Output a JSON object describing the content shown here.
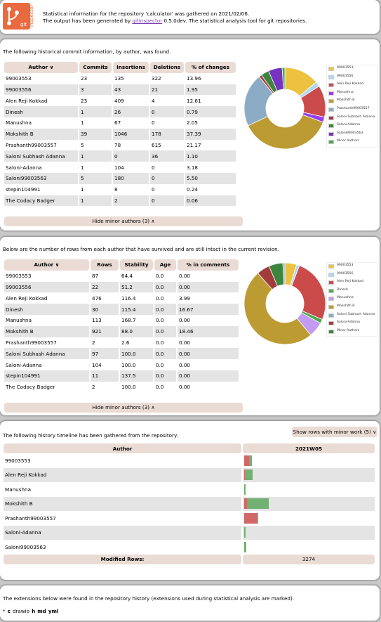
{
  "header": {
    "logo_text": "git",
    "logo_side_text": "inspector",
    "line1": "Statistical information for the repository 'calculator' was gathered on 2021/02/06.",
    "line2_prefix": "The output has been generated by ",
    "line2_link": "gitinspector",
    "line2_suffix": " 0.5.0dev. The statistical analysis tool for git repositories."
  },
  "colors": {
    "pie": [
      "#edc240",
      "#afd8f8",
      "#cb4b4b",
      "#4da74d",
      "#9440ed",
      "#bd9b33",
      "#8cacc6",
      "#a23c3c",
      "#3d853d",
      "#7633bd",
      "#4da74d",
      "#cba63a"
    ]
  },
  "commits": {
    "intro": "The following historical commit information, by author, was found.",
    "headers": [
      "Author ∨",
      "Commits",
      "Insertions",
      "Deletions",
      "% of changes"
    ],
    "rows": [
      [
        "99003553",
        "23",
        "135",
        "322",
        "13.96"
      ],
      [
        "99003556",
        "3",
        "43",
        "21",
        "1.95"
      ],
      [
        "Alen Reji Kokkad",
        "23",
        "409",
        "4",
        "12.61"
      ],
      [
        "Dinesh",
        "1",
        "26",
        "0",
        "0.79"
      ],
      [
        "Manushna",
        "1",
        "67",
        "0",
        "2.05"
      ],
      [
        "Mokshith B",
        "39",
        "1046",
        "178",
        "37.39"
      ],
      [
        "Prashanth99003557",
        "5",
        "78",
        "615",
        "21.17"
      ],
      [
        "Saloni Subhash Adanna",
        "1",
        "0",
        "36",
        "1.10"
      ],
      [
        "Saloni-Adanna",
        "1",
        "104",
        "0",
        "3.18"
      ],
      [
        "Saloni99003563",
        "5",
        "180",
        "0",
        "5.50"
      ],
      [
        "stepin104991",
        "1",
        "8",
        "0",
        "0.24"
      ],
      [
        "The Codacy Badger",
        "1",
        "2",
        "0",
        "0.06"
      ]
    ],
    "hide_label": "Hide minor authors (3) ∧",
    "legend": [
      {
        "label": "99003553",
        "color": "#edc240"
      },
      {
        "label": "99003556",
        "color": "#afd8f8"
      },
      {
        "label": "Alen Reji Kokkad",
        "color": "#cb4b4b"
      },
      {
        "label": "Manushna",
        "color": "#9440ed"
      },
      {
        "label": "Mokshith B",
        "color": "#bd9b33"
      },
      {
        "label": "Prashanth99003557",
        "color": "#8cacc6"
      },
      {
        "label": "Saloni Subhash Adanna",
        "color": "#a23c3c"
      },
      {
        "label": "Saloni-Adanna",
        "color": "#3d853d"
      },
      {
        "label": "Saloni99003563",
        "color": "#7633bd"
      },
      {
        "label": "Minor Authors",
        "color": "#4da74d"
      }
    ],
    "pie": [
      {
        "label": "99003553",
        "value": 13.96,
        "color": "#edc240"
      },
      {
        "label": "99003556",
        "value": 1.95,
        "color": "#afd8f8"
      },
      {
        "label": "Alen Reji Kokkad",
        "value": 12.61,
        "color": "#cb4b4b"
      },
      {
        "label": "Manushna",
        "value": 2.05,
        "color": "#9440ed"
      },
      {
        "label": "Mokshith B",
        "value": 37.39,
        "color": "#bd9b33"
      },
      {
        "label": "Prashanth99003557",
        "value": 21.17,
        "color": "#8cacc6"
      },
      {
        "label": "Saloni Subhash Adanna",
        "value": 1.1,
        "color": "#a23c3c"
      },
      {
        "label": "Saloni-Adanna",
        "value": 3.18,
        "color": "#3d853d"
      },
      {
        "label": "Saloni99003563",
        "value": 5.5,
        "color": "#7633bd"
      },
      {
        "label": "Minor Authors",
        "value": 1.09,
        "color": "#4da74d"
      }
    ]
  },
  "blame": {
    "intro": "Below are the number of rows from each author that have survived and are still intact in the current revision.",
    "headers": [
      "Author ∨",
      "Rows",
      "Stability",
      "Age",
      "% in comments"
    ],
    "rows": [
      [
        "99003553",
        "87",
        "64.4",
        "0.0",
        "0.00"
      ],
      [
        "99003556",
        "22",
        "51.2",
        "0.0",
        "0.00"
      ],
      [
        "Alen Reji Kokkad",
        "476",
        "116.4",
        "0.0",
        "3.99"
      ],
      [
        "Dinesh",
        "30",
        "115.4",
        "0.0",
        "16.67"
      ],
      [
        "Manushna",
        "113",
        "168.7",
        "0.0",
        "0.00"
      ],
      [
        "Mokshith B",
        "921",
        "88.0",
        "0.0",
        "18.46"
      ],
      [
        "Prashanth99003557",
        "2",
        "2.6",
        "0.0",
        "0.00"
      ],
      [
        "Saloni Subhash Adanna",
        "97",
        "100.0",
        "0.0",
        "0.00"
      ],
      [
        "Saloni-Adanna",
        "104",
        "100.0",
        "0.0",
        "0.00"
      ],
      [
        "stepin104991",
        "11",
        "137.5",
        "0.0",
        "0.00"
      ],
      [
        "The Codacy Badger",
        "2",
        "100.0",
        "0.0",
        "0.00"
      ]
    ],
    "hide_label": "Hide minor authors (3) ∧",
    "legend": [
      {
        "label": "99003553",
        "color": "#edc240"
      },
      {
        "label": "99003556",
        "color": "#afd8f8"
      },
      {
        "label": "Alen Reji Kokkad",
        "color": "#cb4b4b"
      },
      {
        "label": "Dinesh",
        "color": "#4da74d"
      },
      {
        "label": "Manushna",
        "color": "#c49bf2"
      },
      {
        "label": "Mokshith B",
        "color": "#bd9b33"
      },
      {
        "label": "Saloni Subhash Adanna",
        "color": "#8cacc6"
      },
      {
        "label": "Saloni-Adanna",
        "color": "#a23c3c"
      },
      {
        "label": "Minor Authors",
        "color": "#3d853d"
      }
    ],
    "pie": [
      {
        "label": "99003553",
        "value": 87,
        "color": "#edc240"
      },
      {
        "label": "99003556",
        "value": 22,
        "color": "#afd8f8"
      },
      {
        "label": "Alen Reji Kokkad",
        "value": 476,
        "color": "#cb4b4b"
      },
      {
        "label": "Dinesh",
        "value": 30,
        "color": "#4da74d"
      },
      {
        "label": "Manushna",
        "value": 113,
        "color": "#c49bf2"
      },
      {
        "label": "Mokshith B",
        "value": 921,
        "color": "#bd9b33"
      },
      {
        "label": "Saloni Subhash Adanna",
        "value": 97,
        "color": "#a23c3c"
      },
      {
        "label": "Saloni-Adanna",
        "value": 104,
        "color": "#3d853d"
      },
      {
        "label": "Minor Authors",
        "value": 15,
        "color": "#8cacc6"
      }
    ]
  },
  "timeline": {
    "intro": "The following history timeline has been gathered from the repository.",
    "toggle_label": "Show rows with minor work (5) ∨",
    "headers": [
      "Author",
      "2021W05"
    ],
    "rows": [
      {
        "author": "99003553",
        "del": 0.04,
        "ins": 0.02
      },
      {
        "author": "Alen Reji Kokkad",
        "del": 0.005,
        "ins": 0.06
      },
      {
        "author": "Manushna",
        "del": 0,
        "ins": 0.008
      },
      {
        "author": "Mokshith B",
        "del": 0.02,
        "ins": 0.17
      },
      {
        "author": "Prashanth99003557",
        "del": 0.1,
        "ins": 0.012
      },
      {
        "author": "Saloni-Adanna",
        "del": 0,
        "ins": 0.01
      },
      {
        "author": "Saloni99003563",
        "del": 0,
        "ins": 0.018
      }
    ],
    "footer_label": "Modified Rows:",
    "footer_value": "3274"
  },
  "extensions": {
    "intro": "The extensions below were found in the repository history (extensions used during statistical analysis are marked).",
    "items": [
      "*",
      "c",
      "drawio",
      "h",
      "md",
      "yml"
    ],
    "marked": [
      "c",
      "h",
      "md",
      "yml"
    ]
  }
}
